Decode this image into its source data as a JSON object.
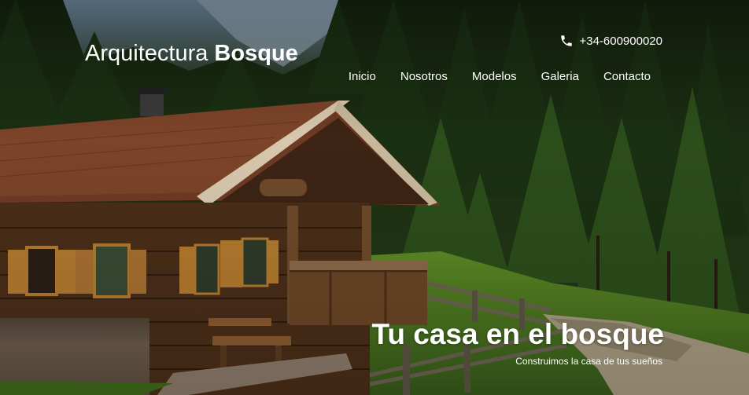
{
  "header": {
    "brand_light": "Arquitectura",
    "brand_bold": "Bosque",
    "phone_icon": "phone-icon",
    "phone": "+34-600900020"
  },
  "nav": {
    "items": [
      {
        "label": "Inicio"
      },
      {
        "label": "Nosotros"
      },
      {
        "label": "Modelos"
      },
      {
        "label": "Galeria"
      },
      {
        "label": "Contacto"
      }
    ]
  },
  "hero": {
    "title": "Tu casa en el bosque",
    "subtitle": "Construimos la casa de tus sueños"
  },
  "colors": {
    "text": "#ffffff",
    "forest": "#1f3518",
    "roof": "#6e3a24",
    "wood": "#5b3a1f",
    "grass": "#4d7a1e"
  }
}
